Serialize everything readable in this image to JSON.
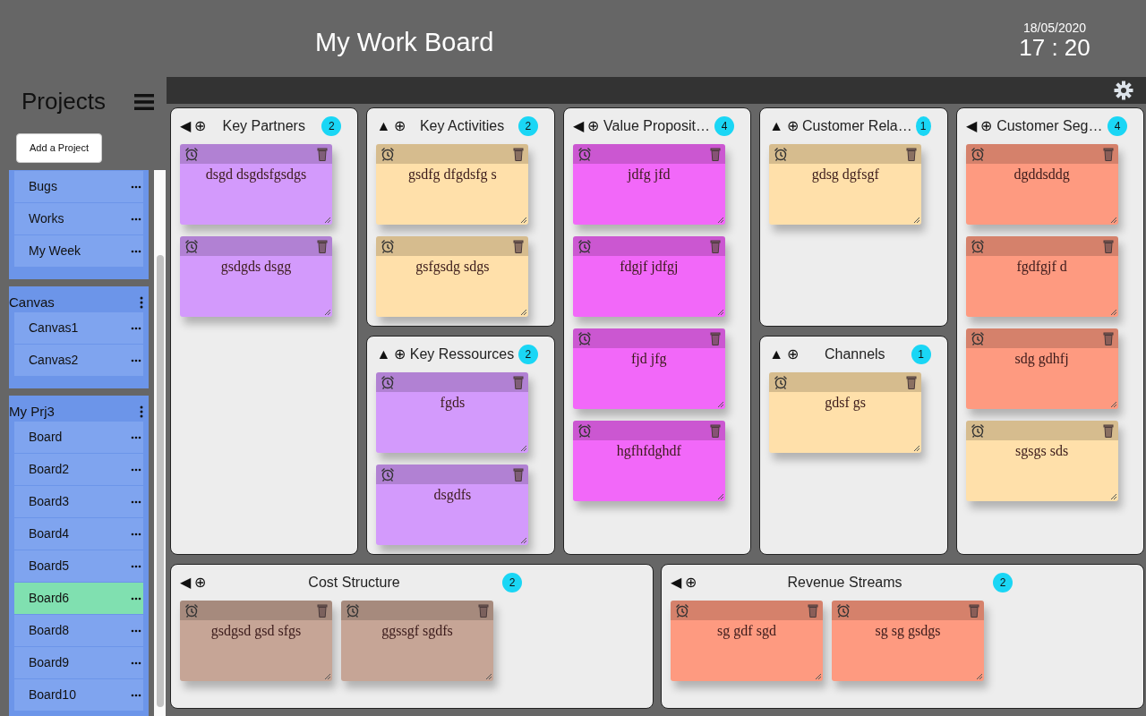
{
  "header": {
    "title": "My Work Board",
    "date": "18/05/2020",
    "time": "17 : 20"
  },
  "sidebar": {
    "title": "Projects",
    "add_button": "Add a Project",
    "groups": [
      {
        "items": [
          {
            "label": "Bugs",
            "selected": false
          },
          {
            "label": "Works",
            "selected": false
          },
          {
            "label": "My Week",
            "selected": false
          }
        ]
      },
      {
        "name": "Canvas",
        "items": [
          {
            "label": "Canvas1",
            "selected": false
          },
          {
            "label": "Canvas2",
            "selected": false
          }
        ]
      },
      {
        "name": "My Prj3",
        "items": [
          {
            "label": "Board",
            "selected": false
          },
          {
            "label": "Board2",
            "selected": false
          },
          {
            "label": "Board3",
            "selected": false
          },
          {
            "label": "Board4",
            "selected": false
          },
          {
            "label": "Board5",
            "selected": false
          },
          {
            "label": "Board6",
            "selected": true
          },
          {
            "label": "Board8",
            "selected": false
          },
          {
            "label": "Board9",
            "selected": false
          },
          {
            "label": "Board10",
            "selected": false
          }
        ]
      }
    ]
  },
  "blocks": [
    {
      "title": "Key Partners",
      "arrow": "◀",
      "add": "⊕",
      "count": "2",
      "notes": [
        {
          "text": "dsgd dsgdsfgsdgs",
          "color": "#d39afc"
        },
        {
          "text": "gsdgds dsgg",
          "color": "#d39afc"
        }
      ]
    },
    {
      "title": "Key Activities",
      "arrow": "▲",
      "add": "⊕",
      "count": "2",
      "notes": [
        {
          "text": "gsdfg dfgdsfg s",
          "color": "#ffe0aa"
        },
        {
          "text": "gsfgsdg sdgs",
          "color": "#ffe0aa"
        }
      ]
    },
    {
      "title": "Key Ressources",
      "arrow": "▲",
      "add": "⊕",
      "count": "2",
      "notes": [
        {
          "text": "fgds",
          "color": "#d39afc"
        },
        {
          "text": "dsgdfs",
          "color": "#d39afc"
        }
      ]
    },
    {
      "title": "Value Proposit…",
      "arrow": "◀",
      "add": "⊕",
      "count": "4",
      "notes": [
        {
          "text": "jdfg jfd",
          "color": "#f268f9"
        },
        {
          "text": "fdgjf jdfgj",
          "color": "#f268f9"
        },
        {
          "text": "fjd jfg",
          "color": "#f268f9"
        },
        {
          "text": "hgfhfdghdf",
          "color": "#f268f9"
        }
      ]
    },
    {
      "title": "Customer Rela…",
      "arrow": "▲",
      "add": "⊕",
      "count": "1",
      "notes": [
        {
          "text": "gdsg dgfsgf",
          "color": "#ffe0aa"
        }
      ]
    },
    {
      "title": "Channels",
      "arrow": "▲",
      "add": "⊕",
      "count": "1",
      "notes": [
        {
          "text": "gdsf gs",
          "color": "#ffe0aa"
        }
      ]
    },
    {
      "title": "Customer Seg…",
      "arrow": "◀",
      "add": "⊕",
      "count": "4",
      "notes": [
        {
          "text": "dgddsddg",
          "color": "#fe9a80"
        },
        {
          "text": "fgdfgjf d",
          "color": "#fe9a80"
        },
        {
          "text": "sdg gdhfj",
          "color": "#fe9a80"
        },
        {
          "text": "sgsgs sds",
          "color": "#ffe0aa"
        }
      ]
    },
    {
      "title": "Cost Structure",
      "arrow": "◀",
      "add": "⊕",
      "count": "2",
      "notes": [
        {
          "text": "gsdgsd gsd sfgs",
          "color": "#c6a596"
        },
        {
          "text": "ggssgf sgdfs",
          "color": "#c6a596"
        }
      ]
    },
    {
      "title": "Revenue Streams",
      "arrow": "◀",
      "add": "⊕",
      "count": "2",
      "notes": [
        {
          "text": "sg gdf sgd",
          "color": "#fe9a80"
        },
        {
          "text": "sg sg gsdgs",
          "color": "#fe9a80"
        }
      ]
    }
  ]
}
